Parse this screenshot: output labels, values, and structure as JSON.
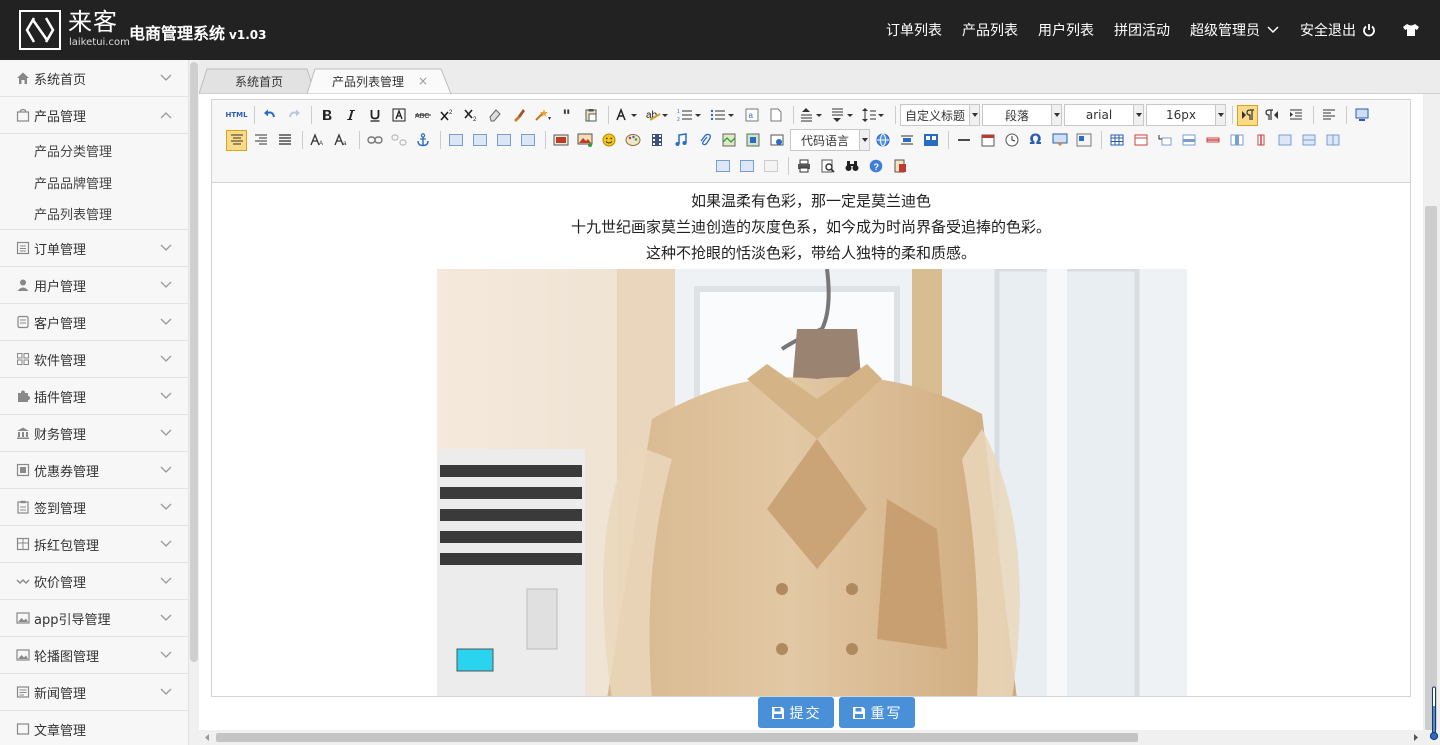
{
  "header": {
    "logo_text": "来客",
    "logo_sub": "laiketui.com",
    "app_title": "电商管理系统",
    "version": "v1.03",
    "nav": [
      {
        "label": "订单列表"
      },
      {
        "label": "产品列表"
      },
      {
        "label": "用户列表"
      },
      {
        "label": "拼团活动"
      },
      {
        "label": "超级管理员"
      },
      {
        "label": "安全退出"
      }
    ]
  },
  "sidebar": {
    "items": [
      {
        "label": "系统首页",
        "icon": "home-icon"
      },
      {
        "label": "产品管理",
        "icon": "bag-icon",
        "expanded": true
      },
      {
        "label": "订单管理",
        "icon": "list-icon"
      },
      {
        "label": "用户管理",
        "icon": "user-icon"
      },
      {
        "label": "客户管理",
        "icon": "doc-icon"
      },
      {
        "label": "软件管理",
        "icon": "grid-icon"
      },
      {
        "label": "插件管理",
        "icon": "puzzle-icon"
      },
      {
        "label": "财务管理",
        "icon": "bank-icon"
      },
      {
        "label": "优惠券管理",
        "icon": "coupon-icon"
      },
      {
        "label": "签到管理",
        "icon": "clipboard-icon"
      },
      {
        "label": "拆红包管理",
        "icon": "gift-icon"
      },
      {
        "label": "砍价管理",
        "icon": "wave-icon"
      },
      {
        "label": "app引导管理",
        "icon": "image-icon"
      },
      {
        "label": "轮播图管理",
        "icon": "image-icon"
      },
      {
        "label": "新闻管理",
        "icon": "news-icon"
      },
      {
        "label": "文章管理",
        "icon": "article-icon"
      }
    ],
    "sub_items": [
      {
        "label": "产品分类管理"
      },
      {
        "label": "产品品牌管理"
      },
      {
        "label": "产品列表管理"
      }
    ]
  },
  "tabs": [
    {
      "label": "系统首页",
      "active": false
    },
    {
      "label": "产品列表管理",
      "active": true,
      "close": "×"
    }
  ],
  "editor": {
    "selects": {
      "heading": "自定义标题",
      "paragraph": "段落",
      "font": "arial",
      "size": "16px",
      "code": "代码语言"
    },
    "html_label": "HTML",
    "lines": [
      "如果温柔有色彩，那一定是莫兰迪色",
      "十九世纪画家莫兰迪创造的灰度色系，如今成为时尚界备受追捧的色彩。",
      "这种不抢眼的恬淡色彩，带给人独特的柔和质感。"
    ]
  },
  "buttons": {
    "submit": "提交",
    "reset": "重写"
  },
  "colors": {
    "topbar": "#222222",
    "accent": "#4a90d9",
    "sidebar": "#f7f7f7"
  }
}
